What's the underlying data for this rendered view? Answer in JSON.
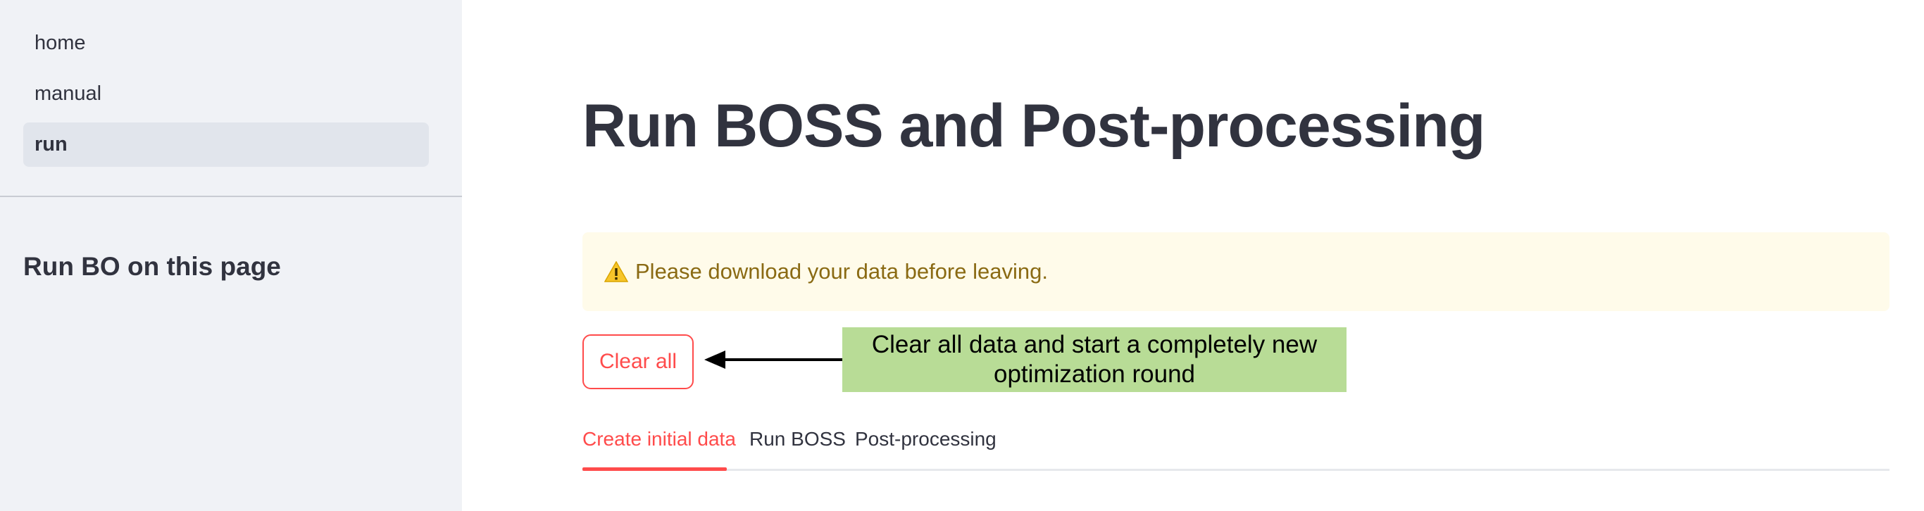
{
  "sidebar": {
    "nav": [
      {
        "label": "home",
        "active": false
      },
      {
        "label": "manual",
        "active": false
      },
      {
        "label": "run",
        "active": true
      }
    ],
    "heading": "Run BO on this page"
  },
  "main": {
    "title": "Run BOSS and Post-processing",
    "warning": {
      "icon": "warning-icon",
      "text": "Please download your data before leaving.",
      "color": "#fffbea"
    },
    "clear_button": {
      "label": "Clear all",
      "color": "#ff4b4b"
    },
    "annotation": {
      "text": "Clear all data and start a completely new optimization round",
      "color": "#b8dc96"
    },
    "tabs": [
      {
        "label": "Create initial data",
        "active": true
      },
      {
        "label": "Run BOSS",
        "active": false
      },
      {
        "label": "Post-processing",
        "active": false
      }
    ]
  }
}
